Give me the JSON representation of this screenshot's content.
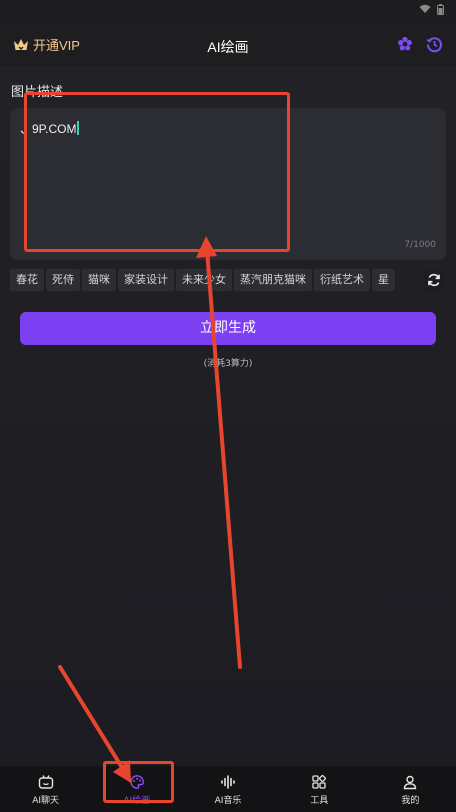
{
  "header": {
    "vip_label": "开通VIP",
    "title": "AI绘画"
  },
  "prompt": {
    "section_label": "图片描述",
    "value": "、9P.COM",
    "char_count": "7/1000"
  },
  "tags": [
    "春花",
    "死侍",
    "猫咪",
    "家装设计",
    "未来少女",
    "蒸汽朋克猫咪",
    "衍纸艺术",
    "星"
  ],
  "actions": {
    "generate_label": "立即生成",
    "cost_note": "(消耗3算力)"
  },
  "nav": [
    {
      "label": "AI聊天",
      "icon": "robot-icon"
    },
    {
      "label": "AI绘画",
      "icon": "palette-icon",
      "active": true
    },
    {
      "label": "AI音乐",
      "icon": "soundwave-icon"
    },
    {
      "label": "工具",
      "icon": "grid-icon"
    },
    {
      "label": "我的",
      "icon": "user-icon"
    }
  ],
  "colors": {
    "accent": "#7c40f2",
    "vip": "#f3c98b",
    "annotation": "#e8452f",
    "background": "#1d1d20"
  }
}
